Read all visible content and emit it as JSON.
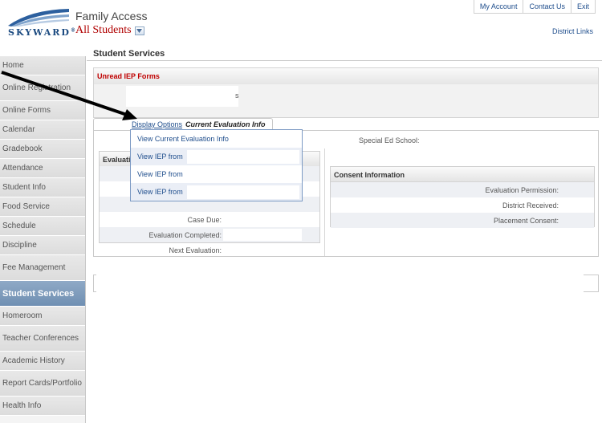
{
  "header": {
    "logo_text": "SKYWARD",
    "logo_mark": "®",
    "app_title": "Family Access",
    "student_selector": "All Students",
    "top_links": [
      "My Account",
      "Contact Us",
      "Exit"
    ],
    "district_links": "District Links"
  },
  "sidebar": {
    "items": [
      {
        "label": "Home"
      },
      {
        "label": "Online Registration"
      },
      {
        "label": "Online Forms"
      },
      {
        "label": "Calendar"
      },
      {
        "label": "Gradebook"
      },
      {
        "label": "Attendance"
      },
      {
        "label": "Student Info"
      },
      {
        "label": "Food Service"
      },
      {
        "label": "Schedule"
      },
      {
        "label": "Discipline"
      },
      {
        "label": "Fee Management"
      },
      {
        "label": "Student Services",
        "active": true
      },
      {
        "label": "Homeroom"
      },
      {
        "label": "Teacher Conferences"
      },
      {
        "label": "Academic History"
      },
      {
        "label": "Report Cards/Portfolio"
      },
      {
        "label": "Health Info"
      }
    ]
  },
  "main": {
    "section_title": "Student Services",
    "iep_forms": {
      "header": "Unread IEP Forms",
      "fragment": "s"
    },
    "tab": {
      "display_options": "Display Options",
      "current": "Current Evaluation Info"
    },
    "special_ed_school_label": "Special Ed School:",
    "evaluation": {
      "header_partial": "Evaluati",
      "rows": [
        "",
        "",
        "",
        "Case Due:",
        "Evaluation Completed:",
        "Next Evaluation:"
      ]
    },
    "consent": {
      "header": "Consent Information",
      "rows": [
        "Evaluation Permission:",
        "District Received:",
        "Placement Consent:"
      ]
    }
  },
  "menu": {
    "items": [
      "View Current Evaluation Info",
      "View IEP from",
      "View IEP from",
      "View IEP from"
    ]
  },
  "colors": {
    "accent_blue": "#1e4d8c",
    "alert_red": "#c00000",
    "active_nav": "#7f9dbd"
  }
}
